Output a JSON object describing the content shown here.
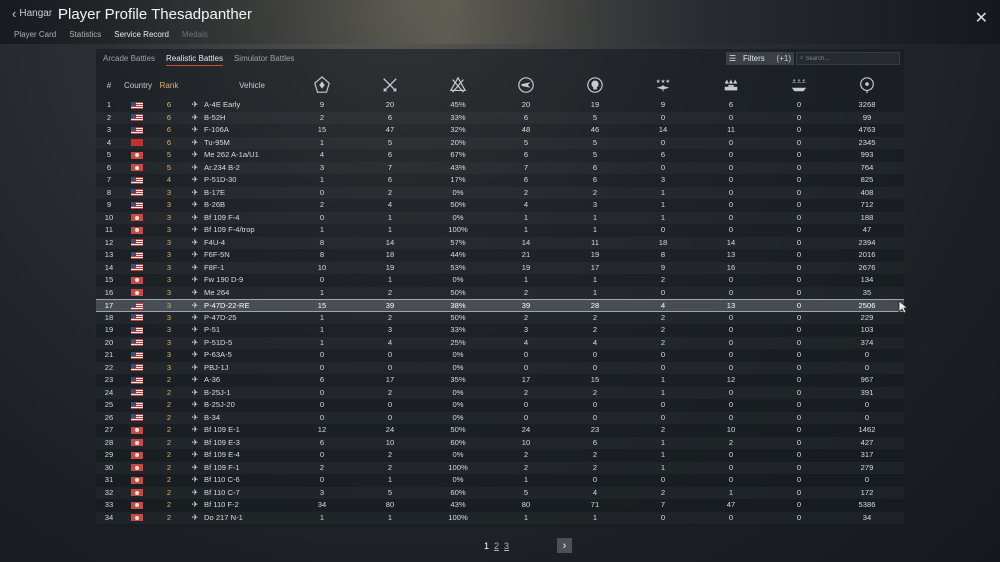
{
  "header": {
    "back_label": "Hangar",
    "title": "Player Profile Thesadpanther",
    "tabs": [
      {
        "label": "Player Card"
      },
      {
        "label": "Statistics"
      },
      {
        "label": "Service Record"
      },
      {
        "label": "Medals"
      }
    ]
  },
  "subtabs": [
    {
      "label": "Arcade Battles"
    },
    {
      "label": "Realistic Battles"
    },
    {
      "label": "Simulator Battles"
    }
  ],
  "filters": {
    "label": "Filters",
    "count": "(+1)"
  },
  "search": {
    "placeholder": "Search..."
  },
  "table": {
    "headers": {
      "num": "#",
      "country": "Country",
      "rank": "Rank",
      "vehicle": "Vehicle"
    },
    "stat_icons": [
      "victories-icon",
      "respawns-icon",
      "win-rate-icon",
      "missions-icon",
      "deaths-icon",
      "air-targets-destroyed-icon",
      "ground-targets-destroyed-icon",
      "naval-targets-destroyed-icon",
      "score-icon"
    ],
    "rows": [
      {
        "n": "1",
        "country": "usa",
        "rank": "6",
        "type": "jet",
        "vehicle": "A-4E Early",
        "s": [
          "9",
          "20",
          "45%",
          "20",
          "19",
          "9",
          "6",
          "0",
          "3268"
        ]
      },
      {
        "n": "2",
        "country": "usa",
        "rank": "6",
        "type": "jet",
        "vehicle": "B-52H",
        "s": [
          "2",
          "6",
          "33%",
          "6",
          "5",
          "0",
          "0",
          "0",
          "99"
        ]
      },
      {
        "n": "3",
        "country": "usa",
        "rank": "6",
        "type": "jet",
        "vehicle": "F-106A",
        "s": [
          "15",
          "47",
          "32%",
          "48",
          "46",
          "14",
          "11",
          "0",
          "4763"
        ]
      },
      {
        "n": "4",
        "country": "ussr",
        "rank": "6",
        "type": "jet",
        "vehicle": "Tu-95M",
        "s": [
          "1",
          "5",
          "20%",
          "5",
          "5",
          "0",
          "0",
          "0",
          "2345"
        ]
      },
      {
        "n": "5",
        "country": "ger",
        "rank": "5",
        "type": "jet",
        "vehicle": "Me 262 A-1a/U1",
        "s": [
          "4",
          "6",
          "67%",
          "6",
          "5",
          "6",
          "0",
          "0",
          "993"
        ]
      },
      {
        "n": "6",
        "country": "ger",
        "rank": "5",
        "type": "jet",
        "vehicle": "Ar.234 B-2",
        "s": [
          "3",
          "7",
          "43%",
          "7",
          "6",
          "0",
          "0",
          "0",
          "764"
        ]
      },
      {
        "n": "7",
        "country": "usa",
        "rank": "4",
        "type": "plane",
        "vehicle": "P-51D-30",
        "s": [
          "1",
          "6",
          "17%",
          "6",
          "6",
          "3",
          "0",
          "0",
          "825"
        ]
      },
      {
        "n": "8",
        "country": "usa",
        "rank": "3",
        "type": "plane",
        "vehicle": "B-17E",
        "s": [
          "0",
          "2",
          "0%",
          "2",
          "2",
          "1",
          "0",
          "0",
          "408"
        ]
      },
      {
        "n": "9",
        "country": "usa",
        "rank": "3",
        "type": "plane",
        "vehicle": "B-26B",
        "s": [
          "2",
          "4",
          "50%",
          "4",
          "3",
          "1",
          "0",
          "0",
          "712"
        ]
      },
      {
        "n": "10",
        "country": "ger",
        "rank": "3",
        "type": "plane",
        "vehicle": "Bf 109 F-4",
        "s": [
          "0",
          "1",
          "0%",
          "1",
          "1",
          "1",
          "0",
          "0",
          "188"
        ]
      },
      {
        "n": "11",
        "country": "ger",
        "rank": "3",
        "type": "plane",
        "vehicle": "Bf 109 F-4/trop",
        "s": [
          "1",
          "1",
          "100%",
          "1",
          "1",
          "0",
          "0",
          "0",
          "47"
        ]
      },
      {
        "n": "12",
        "country": "usa",
        "rank": "3",
        "type": "plane",
        "vehicle": "F4U-4",
        "s": [
          "8",
          "14",
          "57%",
          "14",
          "11",
          "18",
          "14",
          "0",
          "2394"
        ]
      },
      {
        "n": "13",
        "country": "usa",
        "rank": "3",
        "type": "plane",
        "vehicle": "F6F-5N",
        "s": [
          "8",
          "18",
          "44%",
          "21",
          "19",
          "8",
          "13",
          "0",
          "2016"
        ]
      },
      {
        "n": "14",
        "country": "usa",
        "rank": "3",
        "type": "plane",
        "vehicle": "F8F-1",
        "s": [
          "10",
          "19",
          "53%",
          "19",
          "17",
          "9",
          "16",
          "0",
          "2676"
        ]
      },
      {
        "n": "15",
        "country": "ger",
        "rank": "3",
        "type": "plane",
        "vehicle": "Fw 190 D-9",
        "s": [
          "0",
          "1",
          "0%",
          "1",
          "1",
          "2",
          "0",
          "0",
          "134"
        ]
      },
      {
        "n": "16",
        "country": "ger",
        "rank": "3",
        "type": "plane",
        "vehicle": "Me 264",
        "s": [
          "1",
          "2",
          "50%",
          "2",
          "1",
          "0",
          "0",
          "0",
          "35"
        ]
      },
      {
        "n": "17",
        "country": "usa",
        "rank": "3",
        "type": "plane",
        "vehicle": "P-47D-22-RE",
        "s": [
          "15",
          "39",
          "38%",
          "39",
          "28",
          "4",
          "13",
          "0",
          "2506"
        ]
      },
      {
        "n": "18",
        "country": "usa",
        "rank": "3",
        "type": "plane",
        "vehicle": "P-47D-25",
        "s": [
          "1",
          "2",
          "50%",
          "2",
          "2",
          "2",
          "0",
          "0",
          "229"
        ]
      },
      {
        "n": "19",
        "country": "usa",
        "rank": "3",
        "type": "plane",
        "vehicle": "P-51",
        "s": [
          "1",
          "3",
          "33%",
          "3",
          "2",
          "2",
          "0",
          "0",
          "103"
        ]
      },
      {
        "n": "20",
        "country": "usa",
        "rank": "3",
        "type": "plane",
        "vehicle": "P-51D-5",
        "s": [
          "1",
          "4",
          "25%",
          "4",
          "4",
          "2",
          "0",
          "0",
          "374"
        ]
      },
      {
        "n": "21",
        "country": "usa",
        "rank": "3",
        "type": "plane",
        "vehicle": "P-63A-5",
        "s": [
          "0",
          "0",
          "0%",
          "0",
          "0",
          "0",
          "0",
          "0",
          "0"
        ]
      },
      {
        "n": "22",
        "country": "usa",
        "rank": "3",
        "type": "plane",
        "vehicle": "PBJ-1J",
        "s": [
          "0",
          "0",
          "0%",
          "0",
          "0",
          "0",
          "0",
          "0",
          "0"
        ]
      },
      {
        "n": "23",
        "country": "usa",
        "rank": "2",
        "type": "plane",
        "vehicle": "A-36",
        "s": [
          "6",
          "17",
          "35%",
          "17",
          "15",
          "1",
          "12",
          "0",
          "967"
        ]
      },
      {
        "n": "24",
        "country": "usa",
        "rank": "2",
        "type": "plane",
        "vehicle": "B-25J-1",
        "s": [
          "0",
          "2",
          "0%",
          "2",
          "2",
          "1",
          "0",
          "0",
          "391"
        ]
      },
      {
        "n": "25",
        "country": "usa",
        "rank": "2",
        "type": "plane",
        "vehicle": "B-25J-20",
        "s": [
          "0",
          "0",
          "0%",
          "0",
          "0",
          "0",
          "0",
          "0",
          "0"
        ]
      },
      {
        "n": "26",
        "country": "usa",
        "rank": "2",
        "type": "plane",
        "vehicle": "B-34",
        "s": [
          "0",
          "0",
          "0%",
          "0",
          "0",
          "0",
          "0",
          "0",
          "0"
        ]
      },
      {
        "n": "27",
        "country": "ger",
        "rank": "2",
        "type": "plane",
        "vehicle": "Bf 109 E-1",
        "s": [
          "12",
          "24",
          "50%",
          "24",
          "23",
          "2",
          "10",
          "0",
          "1462"
        ]
      },
      {
        "n": "28",
        "country": "ger",
        "rank": "2",
        "type": "plane",
        "vehicle": "Bf 109 E-3",
        "s": [
          "6",
          "10",
          "60%",
          "10",
          "6",
          "1",
          "2",
          "0",
          "427"
        ]
      },
      {
        "n": "29",
        "country": "ger",
        "rank": "2",
        "type": "plane",
        "vehicle": "Bf 109 E-4",
        "s": [
          "0",
          "2",
          "0%",
          "2",
          "2",
          "1",
          "0",
          "0",
          "317"
        ]
      },
      {
        "n": "30",
        "country": "ger",
        "rank": "2",
        "type": "plane",
        "vehicle": "Bf 109 F-1",
        "s": [
          "2",
          "2",
          "100%",
          "2",
          "2",
          "1",
          "0",
          "0",
          "279"
        ]
      },
      {
        "n": "31",
        "country": "ger",
        "rank": "2",
        "type": "plane",
        "vehicle": "Bf 110 C-6",
        "s": [
          "0",
          "1",
          "0%",
          "1",
          "0",
          "0",
          "0",
          "0",
          "0"
        ]
      },
      {
        "n": "32",
        "country": "ger",
        "rank": "2",
        "type": "plane",
        "vehicle": "Bf 110 C-7",
        "s": [
          "3",
          "5",
          "60%",
          "5",
          "4",
          "2",
          "1",
          "0",
          "172"
        ]
      },
      {
        "n": "33",
        "country": "ger",
        "rank": "2",
        "type": "plane",
        "vehicle": "Bf 110 F-2",
        "s": [
          "34",
          "80",
          "43%",
          "80",
          "71",
          "7",
          "47",
          "0",
          "5386"
        ]
      },
      {
        "n": "34",
        "country": "ger",
        "rank": "2",
        "type": "plane",
        "vehicle": "Do 217 N-1",
        "s": [
          "1",
          "1",
          "100%",
          "1",
          "1",
          "0",
          "0",
          "0",
          "34"
        ]
      }
    ],
    "highlighted_row": 17
  },
  "pagination": {
    "pages": [
      "1",
      "2",
      "3"
    ],
    "current": "1"
  },
  "colors": {
    "rank": "#d9b56a",
    "accent": "#d04a3a",
    "highlight": "#828c94"
  }
}
